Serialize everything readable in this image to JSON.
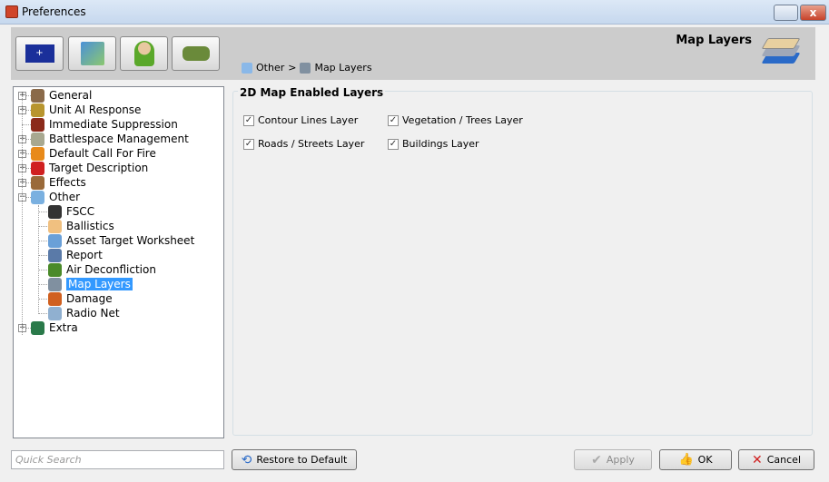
{
  "window": {
    "title": "Preferences",
    "close_glyph": "x"
  },
  "toolbar": {
    "buttons": [
      {
        "icon": "nato-flag-icon"
      },
      {
        "icon": "map-search-icon"
      },
      {
        "icon": "user-icon"
      },
      {
        "icon": "tank-icon"
      }
    ]
  },
  "header": {
    "title": "Map Layers",
    "icon": "map-layers-icon"
  },
  "breadcrumb": {
    "parent": "Other",
    "separator": ">",
    "current": "Map Layers"
  },
  "tree": {
    "items": [
      {
        "label": "General",
        "icon": "tools-icon",
        "color": "#8a6a4a"
      },
      {
        "label": "Unit AI Response",
        "icon": "unit-icon",
        "color": "#b8952e"
      },
      {
        "label": "Immediate Suppression",
        "icon": "suppression-icon",
        "color": "#8b2a1a"
      },
      {
        "label": "Battlespace Management",
        "icon": "tower-icon",
        "color": "#a8a890"
      },
      {
        "label": "Default Call For Fire",
        "icon": "fire-icon",
        "color": "#e88a1a"
      },
      {
        "label": "Target Description",
        "icon": "target-icon",
        "color": "#d02020"
      },
      {
        "label": "Effects",
        "icon": "fx-icon",
        "color": "#9a6a3a"
      },
      {
        "label": "Other",
        "icon": "document-icon",
        "color": "#7ab0e0"
      },
      {
        "label": "FSCC",
        "icon": "camera-icon",
        "color": "#333333"
      },
      {
        "label": "Ballistics",
        "icon": "table-icon",
        "color": "#f0c080"
      },
      {
        "label": "Asset Target Worksheet",
        "icon": "worksheet-icon",
        "color": "#6aa0d8"
      },
      {
        "label": "Report",
        "icon": "report-icon",
        "color": "#5a7aa8"
      },
      {
        "label": "Air Deconfliction",
        "icon": "air-icon",
        "color": "#4a8a2a"
      },
      {
        "label": "Map Layers",
        "icon": "map-layers-icon",
        "color": "#8090a0"
      },
      {
        "label": "Damage",
        "icon": "damage-icon",
        "color": "#d06020"
      },
      {
        "label": "Radio Net",
        "icon": "radio-icon",
        "color": "#90b0d0"
      },
      {
        "label": "Extra",
        "icon": "download-icon",
        "color": "#2a7a4a"
      }
    ],
    "selected": "Map Layers"
  },
  "group": {
    "title": "2D Map Enabled Layers",
    "layers": [
      {
        "label": "Contour Lines Layer",
        "checked": true
      },
      {
        "label": "Vegetation / Trees Layer",
        "checked": true
      },
      {
        "label": "Roads / Streets Layer",
        "checked": true
      },
      {
        "label": "Buildings Layer",
        "checked": true
      }
    ]
  },
  "search": {
    "placeholder": "Quick Search"
  },
  "buttons": {
    "restore": "Restore to Default",
    "apply": "Apply",
    "ok": "OK",
    "cancel": "Cancel"
  },
  "check_glyph": "✓"
}
